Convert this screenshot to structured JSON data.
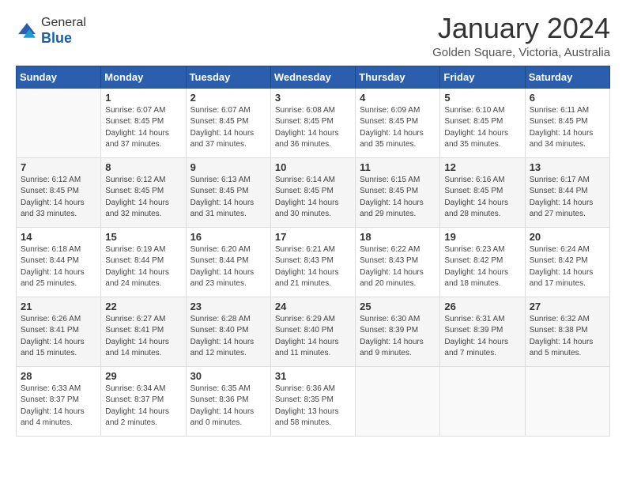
{
  "header": {
    "logo_general": "General",
    "logo_blue": "Blue",
    "month": "January 2024",
    "location": "Golden Square, Victoria, Australia"
  },
  "weekdays": [
    "Sunday",
    "Monday",
    "Tuesday",
    "Wednesday",
    "Thursday",
    "Friday",
    "Saturday"
  ],
  "weeks": [
    [
      {
        "day": "",
        "info": ""
      },
      {
        "day": "1",
        "info": "Sunrise: 6:07 AM\nSunset: 8:45 PM\nDaylight: 14 hours\nand 37 minutes."
      },
      {
        "day": "2",
        "info": "Sunrise: 6:07 AM\nSunset: 8:45 PM\nDaylight: 14 hours\nand 37 minutes."
      },
      {
        "day": "3",
        "info": "Sunrise: 6:08 AM\nSunset: 8:45 PM\nDaylight: 14 hours\nand 36 minutes."
      },
      {
        "day": "4",
        "info": "Sunrise: 6:09 AM\nSunset: 8:45 PM\nDaylight: 14 hours\nand 35 minutes."
      },
      {
        "day": "5",
        "info": "Sunrise: 6:10 AM\nSunset: 8:45 PM\nDaylight: 14 hours\nand 35 minutes."
      },
      {
        "day": "6",
        "info": "Sunrise: 6:11 AM\nSunset: 8:45 PM\nDaylight: 14 hours\nand 34 minutes."
      }
    ],
    [
      {
        "day": "7",
        "info": "Sunrise: 6:12 AM\nSunset: 8:45 PM\nDaylight: 14 hours\nand 33 minutes."
      },
      {
        "day": "8",
        "info": "Sunrise: 6:12 AM\nSunset: 8:45 PM\nDaylight: 14 hours\nand 32 minutes."
      },
      {
        "day": "9",
        "info": "Sunrise: 6:13 AM\nSunset: 8:45 PM\nDaylight: 14 hours\nand 31 minutes."
      },
      {
        "day": "10",
        "info": "Sunrise: 6:14 AM\nSunset: 8:45 PM\nDaylight: 14 hours\nand 30 minutes."
      },
      {
        "day": "11",
        "info": "Sunrise: 6:15 AM\nSunset: 8:45 PM\nDaylight: 14 hours\nand 29 minutes."
      },
      {
        "day": "12",
        "info": "Sunrise: 6:16 AM\nSunset: 8:45 PM\nDaylight: 14 hours\nand 28 minutes."
      },
      {
        "day": "13",
        "info": "Sunrise: 6:17 AM\nSunset: 8:44 PM\nDaylight: 14 hours\nand 27 minutes."
      }
    ],
    [
      {
        "day": "14",
        "info": "Sunrise: 6:18 AM\nSunset: 8:44 PM\nDaylight: 14 hours\nand 25 minutes."
      },
      {
        "day": "15",
        "info": "Sunrise: 6:19 AM\nSunset: 8:44 PM\nDaylight: 14 hours\nand 24 minutes."
      },
      {
        "day": "16",
        "info": "Sunrise: 6:20 AM\nSunset: 8:44 PM\nDaylight: 14 hours\nand 23 minutes."
      },
      {
        "day": "17",
        "info": "Sunrise: 6:21 AM\nSunset: 8:43 PM\nDaylight: 14 hours\nand 21 minutes."
      },
      {
        "day": "18",
        "info": "Sunrise: 6:22 AM\nSunset: 8:43 PM\nDaylight: 14 hours\nand 20 minutes."
      },
      {
        "day": "19",
        "info": "Sunrise: 6:23 AM\nSunset: 8:42 PM\nDaylight: 14 hours\nand 18 minutes."
      },
      {
        "day": "20",
        "info": "Sunrise: 6:24 AM\nSunset: 8:42 PM\nDaylight: 14 hours\nand 17 minutes."
      }
    ],
    [
      {
        "day": "21",
        "info": "Sunrise: 6:26 AM\nSunset: 8:41 PM\nDaylight: 14 hours\nand 15 minutes."
      },
      {
        "day": "22",
        "info": "Sunrise: 6:27 AM\nSunset: 8:41 PM\nDaylight: 14 hours\nand 14 minutes."
      },
      {
        "day": "23",
        "info": "Sunrise: 6:28 AM\nSunset: 8:40 PM\nDaylight: 14 hours\nand 12 minutes."
      },
      {
        "day": "24",
        "info": "Sunrise: 6:29 AM\nSunset: 8:40 PM\nDaylight: 14 hours\nand 11 minutes."
      },
      {
        "day": "25",
        "info": "Sunrise: 6:30 AM\nSunset: 8:39 PM\nDaylight: 14 hours\nand 9 minutes."
      },
      {
        "day": "26",
        "info": "Sunrise: 6:31 AM\nSunset: 8:39 PM\nDaylight: 14 hours\nand 7 minutes."
      },
      {
        "day": "27",
        "info": "Sunrise: 6:32 AM\nSunset: 8:38 PM\nDaylight: 14 hours\nand 5 minutes."
      }
    ],
    [
      {
        "day": "28",
        "info": "Sunrise: 6:33 AM\nSunset: 8:37 PM\nDaylight: 14 hours\nand 4 minutes."
      },
      {
        "day": "29",
        "info": "Sunrise: 6:34 AM\nSunset: 8:37 PM\nDaylight: 14 hours\nand 2 minutes."
      },
      {
        "day": "30",
        "info": "Sunrise: 6:35 AM\nSunset: 8:36 PM\nDaylight: 14 hours\nand 0 minutes."
      },
      {
        "day": "31",
        "info": "Sunrise: 6:36 AM\nSunset: 8:35 PM\nDaylight: 13 hours\nand 58 minutes."
      },
      {
        "day": "",
        "info": ""
      },
      {
        "day": "",
        "info": ""
      },
      {
        "day": "",
        "info": ""
      }
    ]
  ]
}
